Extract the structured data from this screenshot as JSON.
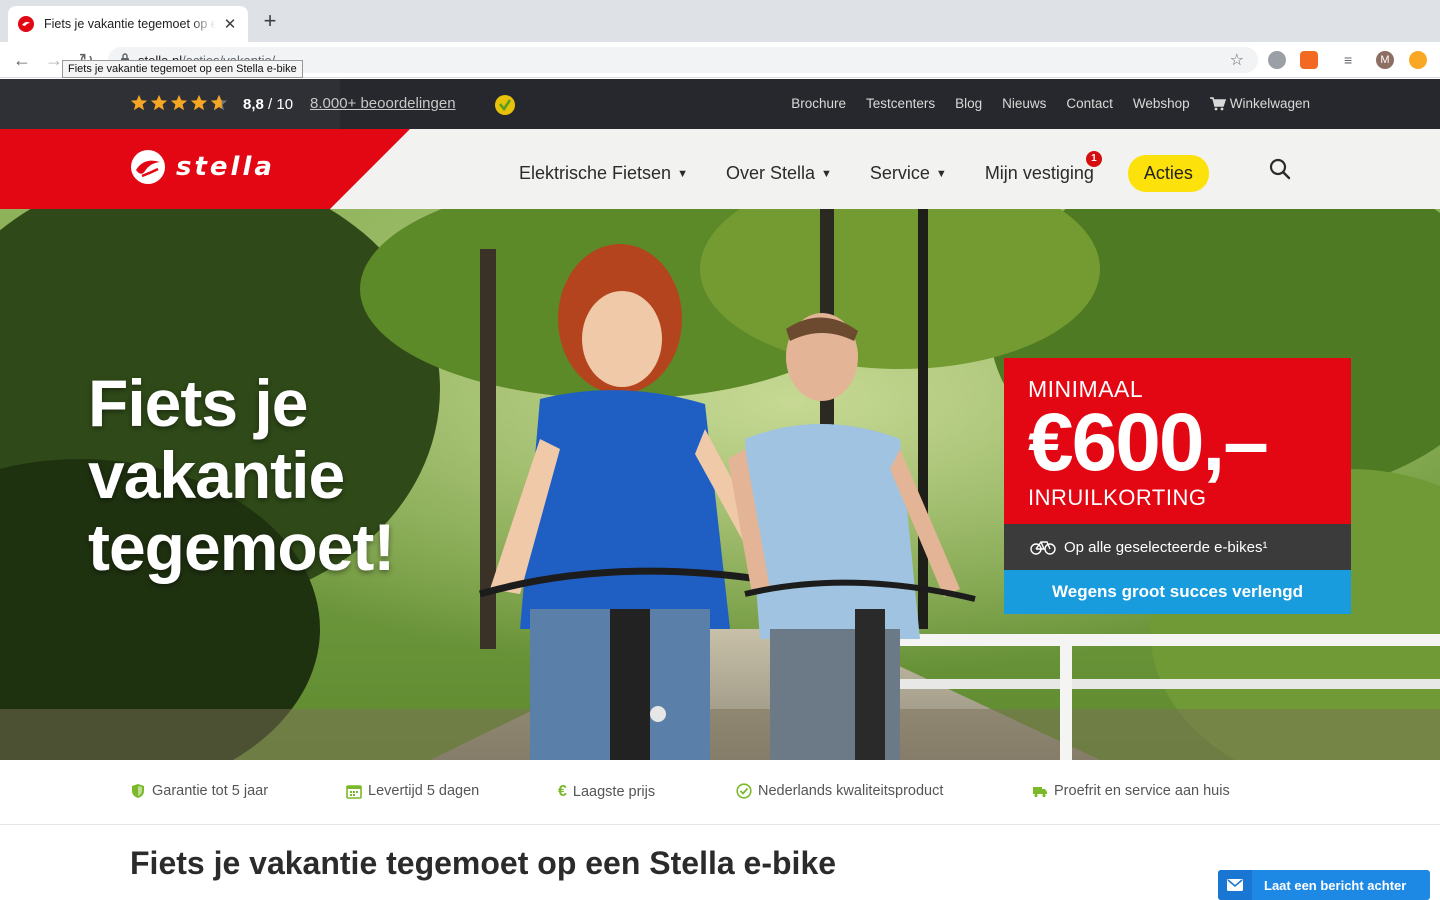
{
  "browser": {
    "tab_title": "Fiets je vakantie tegemoet op een Stella e-bike",
    "url_host": "stella.nl",
    "url_path": "/acties/vakantie/",
    "tooltip": "Fiets je vakantie tegemoet op een Stella e-bike",
    "profile_initial": "M"
  },
  "topbar": {
    "rating_value": "8,8",
    "rating_scale": "/ 10",
    "reviews_link": "8.000+ beoordelingen",
    "links": [
      "Brochure",
      "Testcenters",
      "Blog",
      "Nieuws",
      "Contact",
      "Webshop"
    ],
    "cart_label": "Winkelwagen"
  },
  "header": {
    "logo_text": "stella",
    "nav": {
      "electric_bikes": "Elektrische Fietsen",
      "about": "Over Stella",
      "service": "Service",
      "my_store": "Mijn vestiging",
      "my_store_badge": "1",
      "deals": "Acties"
    }
  },
  "hero": {
    "headline_line1": "Fiets je",
    "headline_line2": "vakantie",
    "headline_line3": "tegemoet!",
    "promo": {
      "minimum": "MINIMAAL",
      "amount": "€600,–",
      "trade_in": "INRUILKORTING",
      "selected": "Op alle geselecteerde e-bikes¹",
      "extended": "Wegens groot succes verlengd"
    }
  },
  "usps": [
    "Garantie tot 5 jaar",
    "Levertijd 5 dagen",
    "Laagste prijs",
    "Nederlands kwaliteitsproduct",
    "Proefrit en service aan huis"
  ],
  "page_title": "Fiets je vakantie tegemoet op een Stella e-bike",
  "chat_button": "Laat een bericht achter",
  "colors": {
    "brand_red": "#e30613",
    "accent_yellow": "#fde10a",
    "usp_green": "#7ab929",
    "promo_blue": "#199cdd",
    "topbar_dark": "#26282d"
  }
}
